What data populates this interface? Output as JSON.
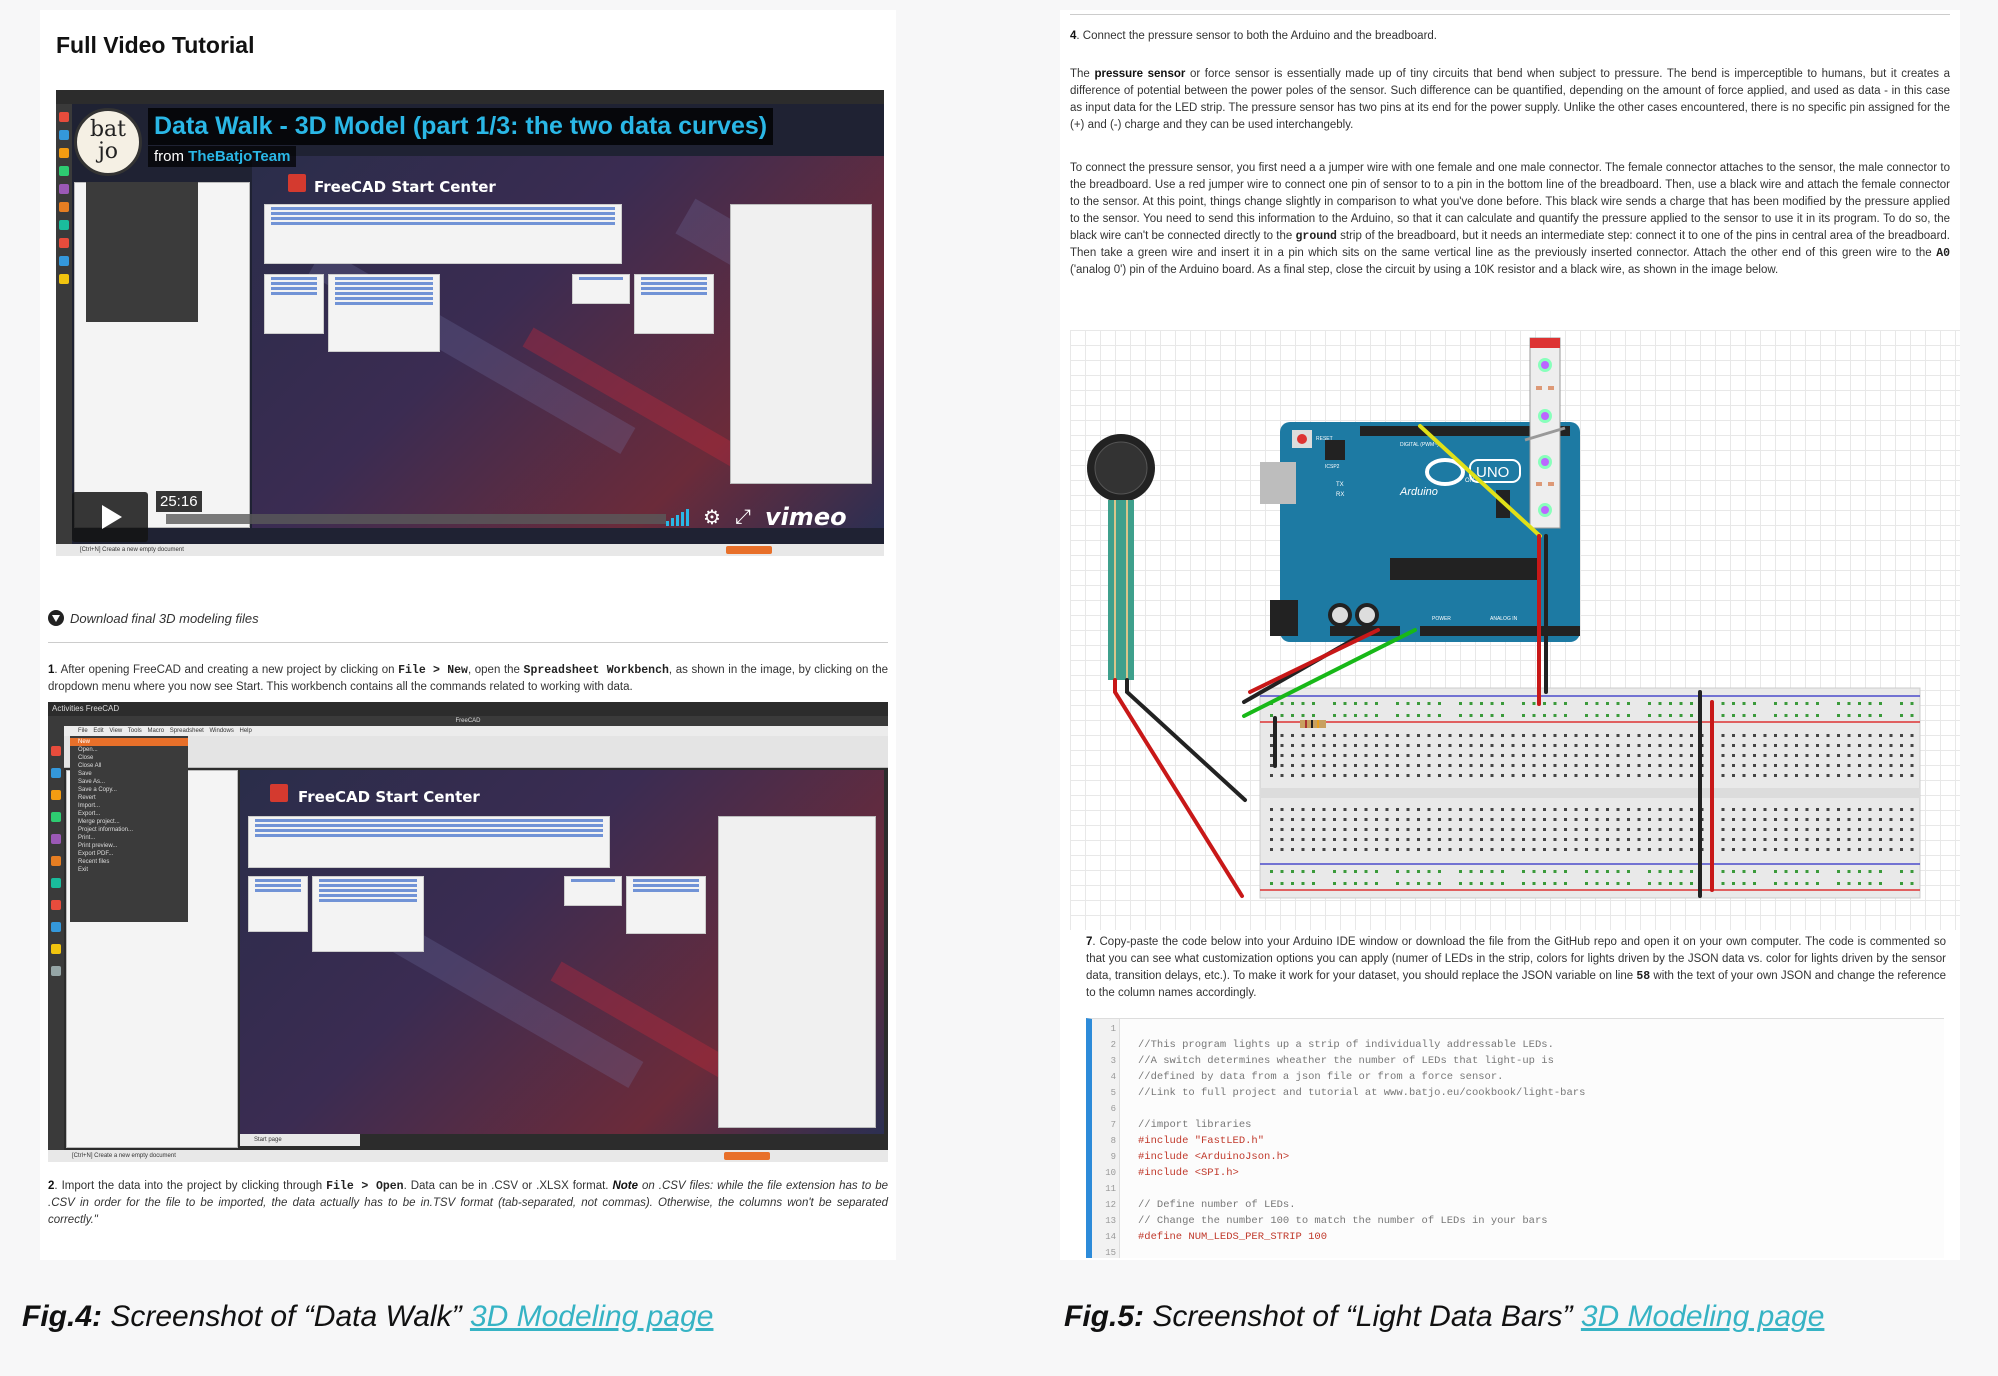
{
  "left": {
    "heading": "Full Video Tutorial",
    "video": {
      "logo_lines": [
        "bat",
        "jo"
      ],
      "title": "Data Walk - 3D Model (part 1/3: the two data curves)",
      "from_prefix": "from",
      "from_author": "TheBatjoTeam",
      "duration": "25:16",
      "brand": "vimeo",
      "freecad_title": "FreeCAD Start Center",
      "status_text": "[Ctrl+N] Create a new empty document"
    },
    "download_link": "Download final 3D modeling files",
    "step1": {
      "num": "1",
      "t1": ". After opening FreeCAD and creating a new project by clicking on ",
      "c1": "File > New",
      "t2": ", open the ",
      "c2": "Spreadsheet Workbench",
      "t3": ", as shown in the image, by clicking on the dropdown menu where you now see Start. This workbench contains all the commands related to working with data."
    },
    "shot2": {
      "topbar": "Activities   FreeCAD",
      "menubar": "File  Edit  View  Tools  Macro  Spreadsheet  Windows  Help",
      "window_title": "FreeCAD",
      "freecad_title": "FreeCAD Start Center",
      "tab_label": "Start page",
      "status_text": "[Ctrl+N] Create a new empty document",
      "menu_items": [
        "New",
        "Open...",
        "Close",
        "Close All",
        "Save",
        "Save As...",
        "Save a Copy...",
        "Revert",
        "Import...",
        "Export...",
        "Merge project...",
        "Project information...",
        "Print...",
        "Print preview...",
        "Export PDF...",
        "Recent files",
        "Exit"
      ]
    },
    "step2": {
      "num": "2",
      "t1": ". Import the data into the project by clicking through ",
      "c1": "File > Open",
      "t2": ". Data can be in .CSV or .XLSX format. ",
      "note": "Note",
      "t3": " on .CSV files: while the file extension has to be .CSV in order for the file to be imported, the data actually has to be in.TSV format (tab-separated, not commas). Otherwise, the columns won't be separated correctly.\""
    },
    "caption": {
      "fig": "Fig.4:",
      "text": " Screenshot of “Data Walk” ",
      "link": "3D Modeling page"
    }
  },
  "right": {
    "step4": {
      "num": "4",
      "text": ". Connect the pressure sensor to both the Arduino and the breadboard."
    },
    "para1": {
      "lead": "The ",
      "bold": "pressure sensor",
      "rest": " or force sensor is essentially made up of tiny circuits that bend when subject to pressure. The bend is imperceptible to humans, but it creates a difference of potential between the power poles of the sensor. Such difference can be quantified, depending on the amount of force applied, and used as data - in this case as input data for the LED strip. The pressure sensor has two pins at its end for the power supply. Unlike the other cases encountered, there is no specific pin assigned for the (+) and (-) charge and they can be used interchangebly."
    },
    "para2": {
      "t1": "To connect the pressure sensor, you first need a a jumper wire with one female and one male connector. The female connector attaches to the sensor, the male connector to the breadboard. Use a red jumper wire to connect one pin of sensor to to a pin in the bottom line of the breadboard. Then, use a black wire and attach the female connector to the sensor. At this point, things change slightly in comparison to what you've done before. This black wire sends a charge that has been modified by the pressure applied to the sensor. You need to send this information to the Arduino, so that it can calculate and quantify the pressure applied to the sensor to use it in its program. To do so, the black wire can't be connected directly to the ",
      "c1": "ground",
      "t2": " strip of the breadboard, but it needs an intermediate step: connect it to one of the pins in central area of the breadboard. Then take a green wire and insert it in a pin which sits on the same vertical line as the previously inserted connector. Attach the other end of this green wire to the ",
      "c2": "A0",
      "t3": " ('analog 0') pin of the Arduino board. As a final step, close the circuit by using a 10K resistor and a black wire, as shown in the image below."
    },
    "diagram": {
      "board_brand": "Arduino",
      "board_model": "UNO",
      "reset_label": "RESET",
      "icsp_label": "ICSP2",
      "digital_label": "DIGITAL (PWM~)",
      "analog_label": "ANALOG IN",
      "power_label": "POWER",
      "tx_label": "TX",
      "rx_label": "RX",
      "on_label": "ON"
    },
    "step7": {
      "num": "7",
      "t1": ". Copy-paste the code below into your Arduino IDE window or download the file from the GitHub repo and open it on your own computer. The code is commented so that you can see what customization options you can apply (numer of LEDs in the strip, colors for lights driven by the JSON data vs. color for lights driven by the sensor data, transition delays, etc.). To make it work for your dataset, you should replace the JSON variable on line ",
      "c1": "58",
      "t2": " with the text of your own JSON and change the reference to the column names accordingly."
    },
    "code_lines": [
      {
        "n": "1",
        "t": "",
        "k": "c-comment"
      },
      {
        "n": "2",
        "t": "//This program lights up a strip of individually addressable LEDs.",
        "k": "c-comment"
      },
      {
        "n": "3",
        "t": "//A switch determines wheather the number of LEDs that light-up is",
        "k": "c-comment"
      },
      {
        "n": "4",
        "t": "//defined by data from a json file or from a force sensor.",
        "k": "c-comment"
      },
      {
        "n": "5",
        "t": "//Link to full project and tutorial at www.batjo.eu/cookbook/light-bars",
        "k": "c-comment"
      },
      {
        "n": "6",
        "t": "",
        "k": "c-comment"
      },
      {
        "n": "7",
        "t": "//import libraries",
        "k": "c-comment"
      },
      {
        "n": "8",
        "t": "#include \"FastLED.h\"",
        "k": "c-include"
      },
      {
        "n": "9",
        "t": "#include <ArduinoJson.h>",
        "k": "c-include"
      },
      {
        "n": "10",
        "t": "#include <SPI.h>",
        "k": "c-include"
      },
      {
        "n": "11",
        "t": "",
        "k": "c-comment"
      },
      {
        "n": "12",
        "t": "// Define number of LEDs.",
        "k": "c-comment"
      },
      {
        "n": "13",
        "t": "// Change the number 100 to match the number of LEDs in your bars",
        "k": "c-comment"
      },
      {
        "n": "14",
        "t": "#define NUM_LEDS_PER_STRIP 100",
        "k": "c-include"
      },
      {
        "n": "15",
        "t": "",
        "k": "c-comment"
      }
    ],
    "caption": {
      "fig": "Fig.5:",
      "text": " Screenshot of “Light Data Bars” ",
      "link": "3D Modeling page"
    }
  },
  "colors": {
    "link": "#36b3c4",
    "video_title": "#2ab7e6",
    "arduino": "#1d7aa3",
    "code_accent": "#2d8bd9"
  }
}
